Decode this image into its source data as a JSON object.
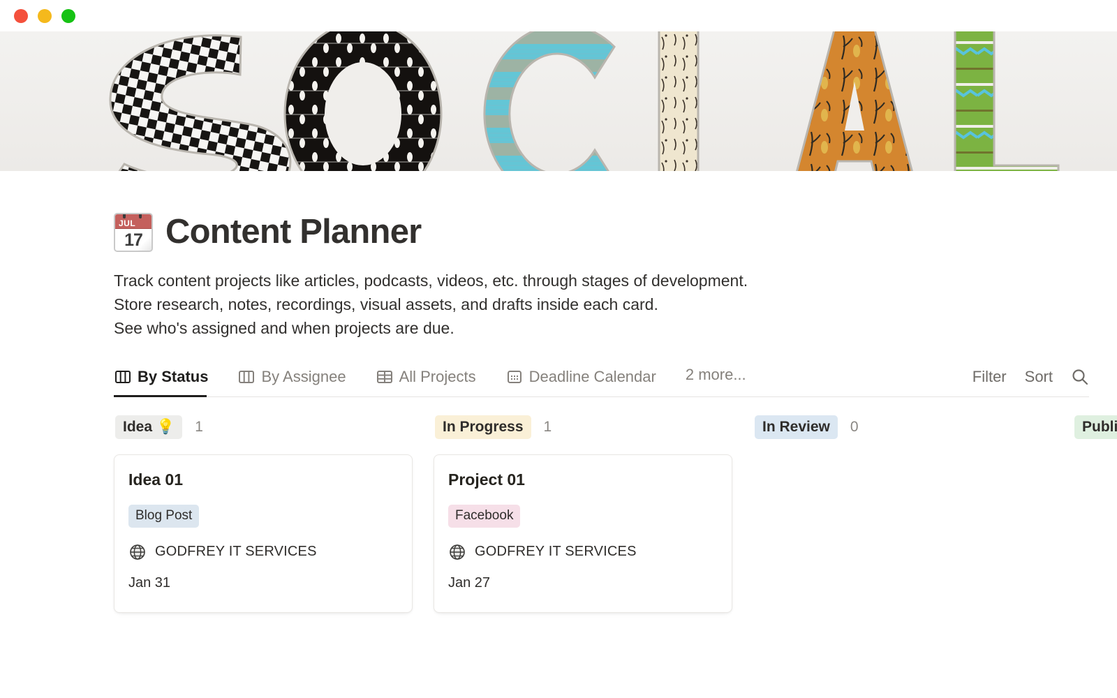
{
  "window": {
    "traffic_lights": [
      {
        "name": "close",
        "color": "#f4503c"
      },
      {
        "name": "minimize",
        "color": "#f5b91c"
      },
      {
        "name": "maximize",
        "color": "#16c214"
      }
    ]
  },
  "banner": {
    "alt_text": "SOCIAL",
    "letters": [
      "S",
      "O",
      "C",
      "I",
      "A",
      "L"
    ]
  },
  "header": {
    "emoji_icon": "calendar-emoji",
    "emoji_month": "JUL",
    "emoji_day": "17",
    "title": "Content Planner",
    "description": [
      "Track content projects like articles, podcasts, videos, etc. through stages of development.",
      "Store research, notes, recordings, visual assets, and drafts inside each card.",
      "See who's assigned and when projects are due."
    ]
  },
  "tabs": [
    {
      "label": "By Status",
      "icon": "board-icon",
      "active": true
    },
    {
      "label": "By Assignee",
      "icon": "board-icon",
      "active": false
    },
    {
      "label": "All Projects",
      "icon": "table-icon",
      "active": false
    },
    {
      "label": "Deadline Calendar",
      "icon": "calendar-icon",
      "active": false
    }
  ],
  "tabs_overflow_label": "2 more...",
  "toolbar": {
    "filter_label": "Filter",
    "sort_label": "Sort",
    "search_icon": "search-icon"
  },
  "board": {
    "columns": [
      {
        "status": "Idea",
        "emoji": "💡",
        "count": "1",
        "pill_bg": "#ededeb",
        "cards": [
          {
            "title": "Idea 01",
            "tag": "Blog Post",
            "tag_bg": "#dce6ef",
            "assignee_icon": "globe-icon",
            "assignee": "GODFREY IT SERVICES",
            "date": "Jan 31"
          }
        ]
      },
      {
        "status": "In Progress",
        "emoji": "",
        "count": "1",
        "pill_bg": "#faf0d7",
        "cards": [
          {
            "title": "Project 01",
            "tag": "Facebook",
            "tag_bg": "#f6dfe8",
            "assignee_icon": "globe-icon",
            "assignee": "GODFREY IT SERVICES",
            "date": "Jan 27"
          }
        ]
      },
      {
        "status": "In Review",
        "emoji": "",
        "count": "0",
        "pill_bg": "#dbe7f2",
        "cards": []
      },
      {
        "status": "Published",
        "emoji": "",
        "count": "",
        "pill_bg": "#dff0e0",
        "cards": []
      }
    ]
  }
}
